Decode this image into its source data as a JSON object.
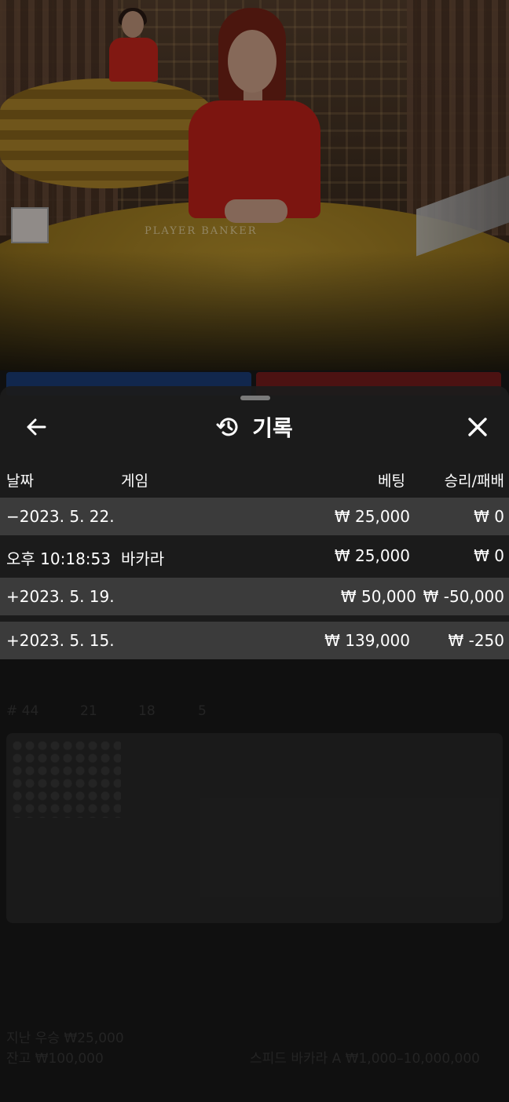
{
  "table_label": "PLAYER      BANKER",
  "history": {
    "title": "기록",
    "columns": {
      "date": "날짜",
      "game": "게임",
      "bet": "베팅",
      "result": "승리/패배"
    },
    "rows": [
      {
        "date": "−2023. 5. 22.",
        "game": "",
        "bet": "₩ 25,000",
        "result": "₩ 0"
      },
      {
        "date": "오후 10:18:53",
        "game": "바카라",
        "bet": "₩ 25,000",
        "result": "₩ 0"
      },
      {
        "date": "+2023. 5. 19.",
        "game": "",
        "bet": "₩ 50,000",
        "result": "₩ -50,000"
      },
      {
        "date": "+2023. 5. 15.",
        "game": "",
        "bet": "₩ 139,000",
        "result": "₩ -250"
      }
    ]
  },
  "underlying": {
    "last_win": "지난 우승 ₩25,000",
    "balance": "잔고 ₩100,000",
    "table_info": "스피드 바카라 A ₩1,000–10,000,000",
    "round_count": "# 44",
    "player_count": "21",
    "banker_count": "18",
    "tie_count": "5"
  },
  "colors": {
    "sheet": "#1c1c1c",
    "row_alt": "#3b3b3b",
    "player_blue": "#1c3f7c",
    "banker_red": "#7b1e1e"
  }
}
